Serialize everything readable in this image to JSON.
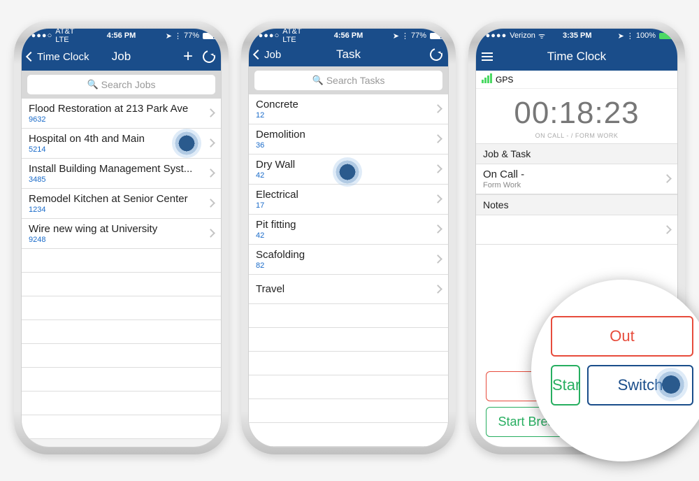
{
  "phone1": {
    "status": {
      "carrier": "AT&T  LTE",
      "time": "4:56 PM",
      "battery": "77%",
      "battery_pct": 77
    },
    "nav": {
      "back": "Time Clock",
      "title": "Job"
    },
    "search_placeholder": "Search Jobs",
    "jobs": [
      {
        "title": "Flood Restoration at 213 Park Ave",
        "code": "9632"
      },
      {
        "title": "Hospital on 4th and Main",
        "code": "5214"
      },
      {
        "title": "Install Building Management Syst...",
        "code": "3485"
      },
      {
        "title": "Remodel Kitchen at Senior Center",
        "code": "1234"
      },
      {
        "title": "Wire new wing at University",
        "code": "9248"
      }
    ]
  },
  "phone2": {
    "status": {
      "carrier": "AT&T  LTE",
      "time": "4:56 PM",
      "battery": "77%",
      "battery_pct": 77
    },
    "nav": {
      "back": "Job",
      "title": "Task"
    },
    "search_placeholder": "Search Tasks",
    "tasks": [
      {
        "title": "Concrete",
        "count": "12"
      },
      {
        "title": "Demolition",
        "count": "36"
      },
      {
        "title": "Dry Wall",
        "count": "42"
      },
      {
        "title": "Electrical",
        "count": "17"
      },
      {
        "title": "Pit fitting",
        "count": "42"
      },
      {
        "title": "Scafolding",
        "count": "82"
      },
      {
        "title": "Travel",
        "count": ""
      }
    ]
  },
  "phone3": {
    "status": {
      "carrier": "Verizon",
      "time": "3:35 PM",
      "battery": "100%",
      "battery_pct": 100
    },
    "nav": {
      "title": "Time Clock"
    },
    "gps_label": "GPS",
    "timer": "00:18:23",
    "timer_sub": "ON CALL -  / FORM WORK",
    "section_jobtask": "Job & Task",
    "jobtask_title": "On Call -",
    "jobtask_sub": "Form Work",
    "section_notes": "Notes",
    "clock_out": "Clock Out",
    "start_break": "Start Break",
    "switch": "Switch",
    "mag_out": "Out",
    "mag_start": "Star",
    "mag_switch": "Switch"
  }
}
